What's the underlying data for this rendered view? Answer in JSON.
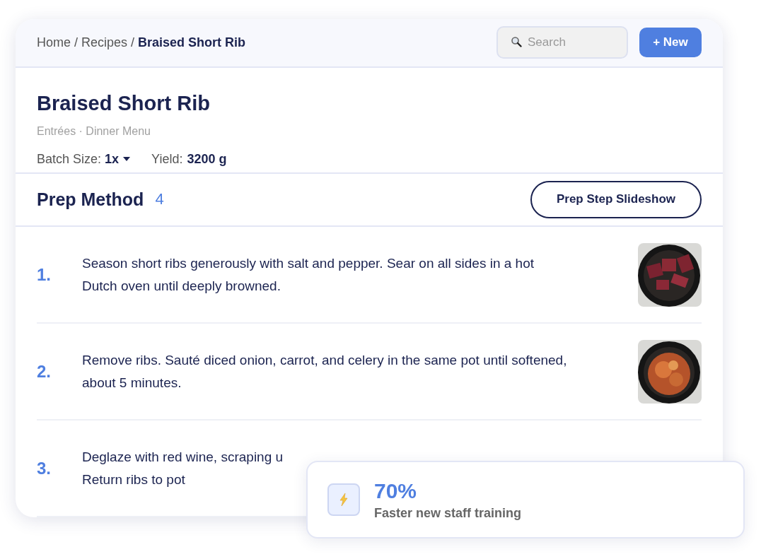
{
  "breadcrumb": [
    {
      "label": "Home",
      "current": false
    },
    {
      "label": "Recipes",
      "current": false
    },
    {
      "label": "Braised Short Rib",
      "current": true
    }
  ],
  "separator": "/",
  "search": {
    "placeholder": "Search"
  },
  "new_button": "+ New",
  "recipe": {
    "title": "Braised Short Rib",
    "subtitle": "Entrées · Dinner Menu",
    "batch_label": "Batch Size:",
    "batch_value": "1x",
    "yield_label": "Yield:",
    "yield_value": "3200 g"
  },
  "prep": {
    "title": "Prep Method",
    "count": "4",
    "slideshow_button": "Prep Step Slideshow"
  },
  "steps": [
    {
      "number": "1.",
      "lines": [
        "Season short ribs generously with salt and pepper. Sear on all sides in a hot",
        "Dutch oven until deeply browned."
      ],
      "photo": {
        "kind": "picture"
      }
    },
    {
      "number": "2.",
      "lines": [
        "Remove ribs. Sauté diced onion, carrot, and celery in the same pot until softened,",
        "about 5 minutes."
      ],
      "photo": {
        "kind": "picture"
      }
    },
    {
      "number": "3.",
      "lines": [
        "Deglaze with red wine, scraping u",
        "Return ribs to pot"
      ]
    }
  ],
  "stat": {
    "value": "70%",
    "label": "Faster new staff training"
  }
}
